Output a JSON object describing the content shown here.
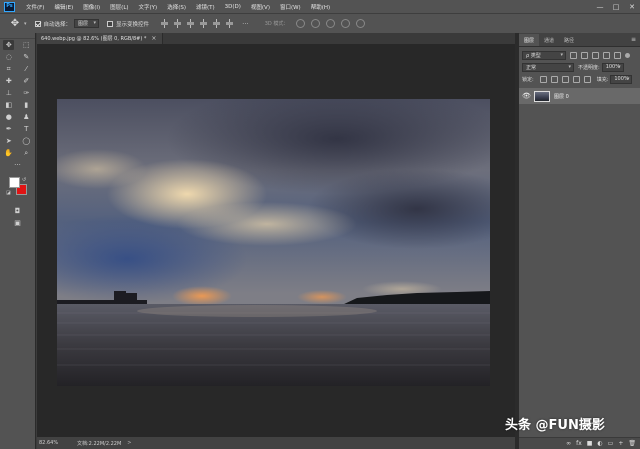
{
  "app": {
    "logo": "Ps"
  },
  "menu": [
    "文件(F)",
    "编辑(E)",
    "图像(I)",
    "图层(L)",
    "文字(Y)",
    "选择(S)",
    "滤镜(T)",
    "3D(D)",
    "视图(V)",
    "窗口(W)",
    "帮助(H)"
  ],
  "window_controls": {
    "minimize": "—",
    "maximize": "□",
    "close": "✕"
  },
  "options_bar": {
    "tool_icon": "move-tool-icon",
    "auto_select_label": "自动选择：",
    "auto_select_value": "图层",
    "show_transform_label": "显示变换控件",
    "mode_3d_label": "3D 模式："
  },
  "document_tab": {
    "title": "640.webp.jpg @ 82.6% (图层 0, RGB/8#) *",
    "close": "×"
  },
  "statusbar": {
    "zoom": "82.64%",
    "doc_info": "文档:2.22M/2.22M",
    "arrow": ">"
  },
  "panel": {
    "tabs": [
      "图层",
      "通道",
      "路径"
    ],
    "menu_icon": "≡",
    "kind_filter": "ρ 类型",
    "blend_mode": "正常",
    "opacity_label": "不透明度:",
    "opacity_value": "100%",
    "lock_label": "锁定:",
    "fill_label": "填充:",
    "fill_value": "100%",
    "layers": [
      {
        "name": "图层 0",
        "visible": true
      }
    ],
    "footer_icons": [
      "∞",
      "fx",
      "■",
      "◐",
      "▭",
      "+",
      "🗑"
    ]
  },
  "colors": {
    "foreground": "#ffffff",
    "background": "#e01414",
    "accent": "#31a8ff"
  },
  "watermark": "头条 @FUN摄影"
}
